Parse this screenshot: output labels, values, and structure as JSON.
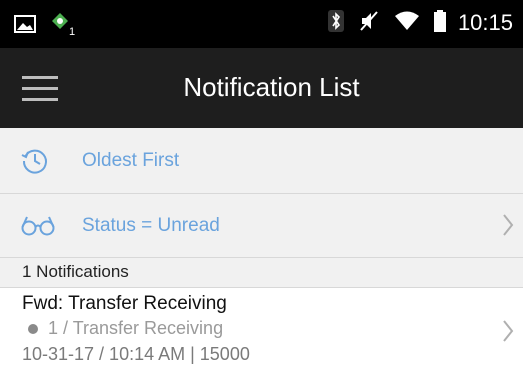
{
  "status_bar": {
    "time": "10:15",
    "left_icons": [
      "image-icon",
      "app-notification-icon"
    ],
    "app_badge": "1",
    "right_icons": [
      "bluetooth-icon",
      "mute-icon",
      "wifi-icon",
      "battery-icon"
    ]
  },
  "app_bar": {
    "title": "Notification List",
    "menu_icon": "hamburger-menu-icon"
  },
  "sort": {
    "label": "Oldest First",
    "icon": "history-icon"
  },
  "filter": {
    "label": "Status = Unread",
    "icon": "glasses-icon"
  },
  "list": {
    "count_label": "1 Notifications",
    "items": [
      {
        "title": "Fwd: Transfer Receiving",
        "subtitle": "1 / Transfer Receiving",
        "meta": "10-31-17 / 10:14 AM | 15000"
      }
    ]
  },
  "colors": {
    "accent": "#6aa3dd",
    "app_bar": "#1e1e1e",
    "status_bar": "#000000",
    "row_bg": "#f1f1f1"
  }
}
